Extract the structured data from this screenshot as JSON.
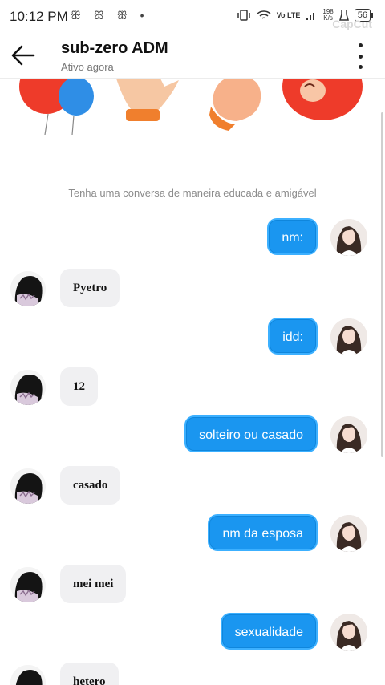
{
  "status_bar": {
    "time": "10:12 PM",
    "notification_icons": "ꕥ ꕥ ꕥ •",
    "network_label": "Vo LTE",
    "speed_value": "198",
    "speed_unit": "K/s",
    "battery": "56",
    "watermark": "CapCut"
  },
  "header": {
    "contact_name": "sub-zero ADM",
    "status": "Ativo agora"
  },
  "system_message": "Tenha uma conversa de maneira educada e amigável",
  "messages": [
    {
      "direction": "out",
      "text": "nm:"
    },
    {
      "direction": "in",
      "text": "Pyetro"
    },
    {
      "direction": "out",
      "text": "idd:"
    },
    {
      "direction": "in",
      "text": "12"
    },
    {
      "direction": "out",
      "text": "solteiro ou casado"
    },
    {
      "direction": "in",
      "text": "casado"
    },
    {
      "direction": "out",
      "text": "nm da esposa"
    },
    {
      "direction": "in",
      "text": "mei mei"
    },
    {
      "direction": "out",
      "text": "sexualidade"
    },
    {
      "direction": "in",
      "text": "hetero"
    }
  ],
  "colors": {
    "outgoing_bubble": "#1a96f0",
    "incoming_bubble": "#f0f0f2"
  }
}
